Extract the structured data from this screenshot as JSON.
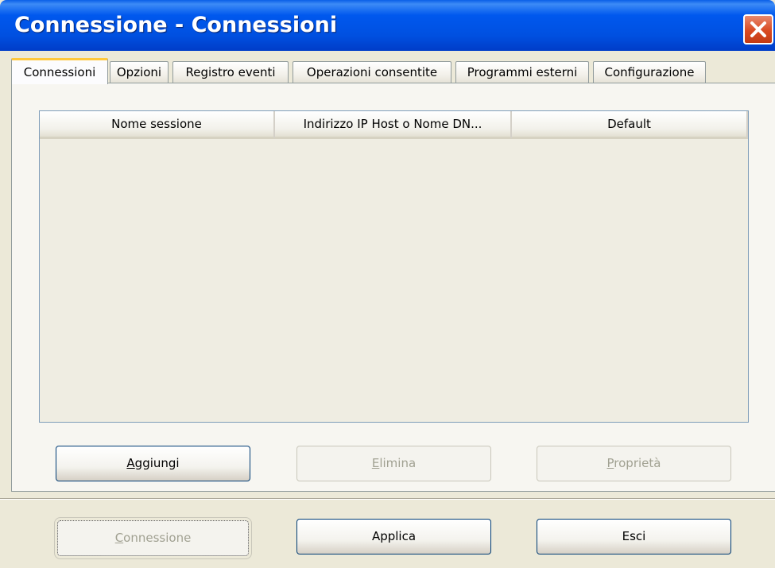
{
  "window": {
    "title": "Connessione - Connessioni",
    "close_icon": "close-x-icon",
    "close_color": "#D94A22",
    "title_bar_color": "#0054E3"
  },
  "tabs": [
    {
      "label": "Connessioni",
      "active": true
    },
    {
      "label": "Opzioni",
      "active": false
    },
    {
      "label": "Registro eventi",
      "active": false
    },
    {
      "label": "Operazioni consentite",
      "active": false
    },
    {
      "label": "Programmi esterni",
      "active": false
    },
    {
      "label": "Configurazione",
      "active": false
    }
  ],
  "sessions_table": {
    "columns": [
      "Nome sessione",
      "Indirizzo IP Host o Nome DN...",
      "Default"
    ],
    "rows": []
  },
  "list_buttons": {
    "add": {
      "label": "Aggiungi",
      "accel": "A",
      "rest": "ggiungi",
      "enabled": true
    },
    "delete": {
      "label": "Elimina",
      "accel": "E",
      "rest": "limina",
      "enabled": false
    },
    "properties": {
      "label": "Proprietà",
      "accel": "P",
      "rest": "roprietà",
      "enabled": false
    }
  },
  "footer_buttons": {
    "connect": {
      "label": "Connessione",
      "accel": "C",
      "rest": "onnessione",
      "enabled": false
    },
    "apply": {
      "label": "Applica",
      "enabled": true
    },
    "exit": {
      "label": "Esci",
      "enabled": true
    }
  }
}
